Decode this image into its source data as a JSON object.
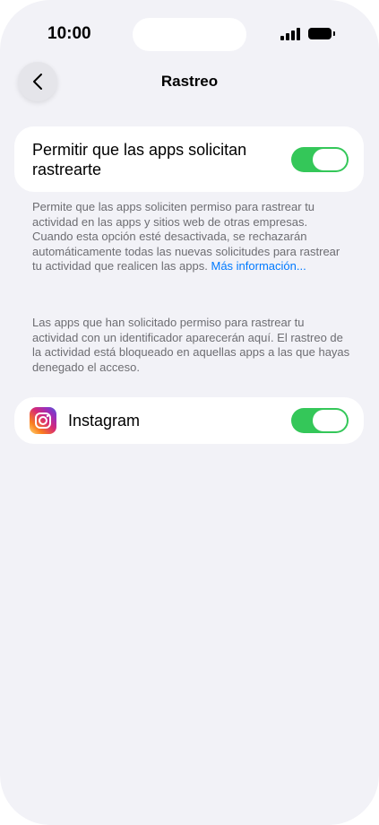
{
  "status_bar": {
    "time": "10:00"
  },
  "nav": {
    "title": "Rastreo",
    "back_icon": "chevron-left-icon"
  },
  "allow_tracking": {
    "label": "Permitir que las apps solicitan rastrearte",
    "enabled": true,
    "toggle_color": "#34c759"
  },
  "description": {
    "text": "Permite que las apps soliciten permiso para rastrear tu actividad en las apps y sitios web de otras empresas. Cuando esta opción esté desactivada, se rechazarán automáticamente todas las nuevas solicitudes para rastrear tu actividad que realicen las apps.",
    "link": "Más información..."
  },
  "apps_note": "Las apps que han solicitado permiso para rastrear tu actividad con un identificador aparecerán aquí. El rastreo de la actividad está bloqueado en aquellas apps a las que hayas denegado el acceso.",
  "apps": [
    {
      "name": "Instagram",
      "icon": "instagram-icon",
      "enabled": true
    }
  ],
  "colors": {
    "accent": "#007aff",
    "background": "#f2f2f7",
    "toggle_on": "#34c759"
  }
}
